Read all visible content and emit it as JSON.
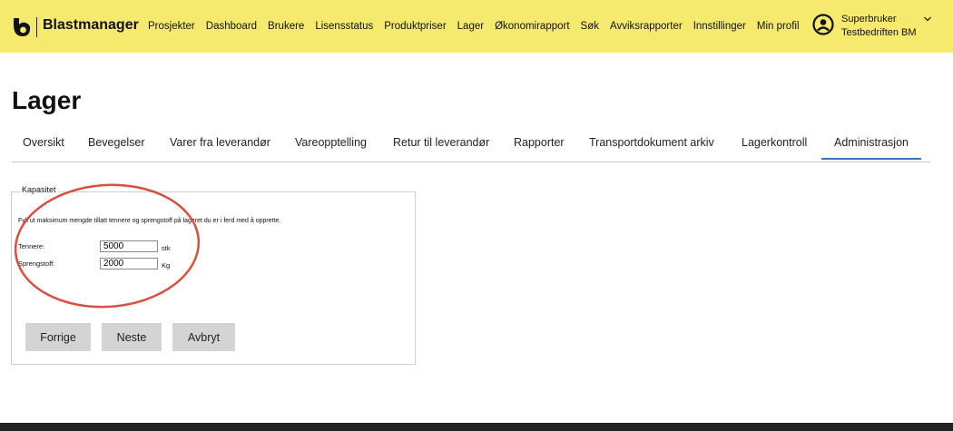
{
  "header": {
    "brand": "Blastmanager",
    "nav": [
      "Prosjekter",
      "Dashboard",
      "Brukere",
      "Lisensstatus",
      "Produktpriser",
      "Lager",
      "Økonomirapport",
      "Søk",
      "Avviksrapporter",
      "Innstillinger",
      "Min profil"
    ],
    "user": {
      "role": "Superbruker",
      "company": "Testbedriften BM"
    }
  },
  "page": {
    "title": "Lager"
  },
  "tabs": [
    "Oversikt",
    "Bevegelser",
    "Varer fra leverandør",
    "Vareopptelling",
    "Retur til leverandør",
    "Rapporter",
    "Transportdokument arkiv",
    "Lagerkontroll",
    "Administrasjon"
  ],
  "active_tab": "Administrasjon",
  "form": {
    "legend": "Kapasitet",
    "intro": "Fyll ut maksimum mengde tillatt tennere og sprengstoff på lageret du er i ferd med å opprette.",
    "fields": [
      {
        "label": "Tennere:",
        "value": "5000",
        "unit": "stk"
      },
      {
        "label": "Sprengstoff:",
        "value": "2000",
        "unit": "Kg"
      }
    ],
    "buttons": {
      "prev": "Forrige",
      "next": "Neste",
      "cancel": "Avbryt"
    }
  },
  "colors": {
    "header_bg": "#f5ea6e",
    "active_tab_underline": "#3a74c9",
    "annotation_circle": "#d9503f",
    "button_bg": "#d4d4d4"
  },
  "icons": {
    "logo": "blastmanager-logo-icon",
    "profile": "user-circle-icon",
    "dropdown": "chevron-down-icon"
  }
}
